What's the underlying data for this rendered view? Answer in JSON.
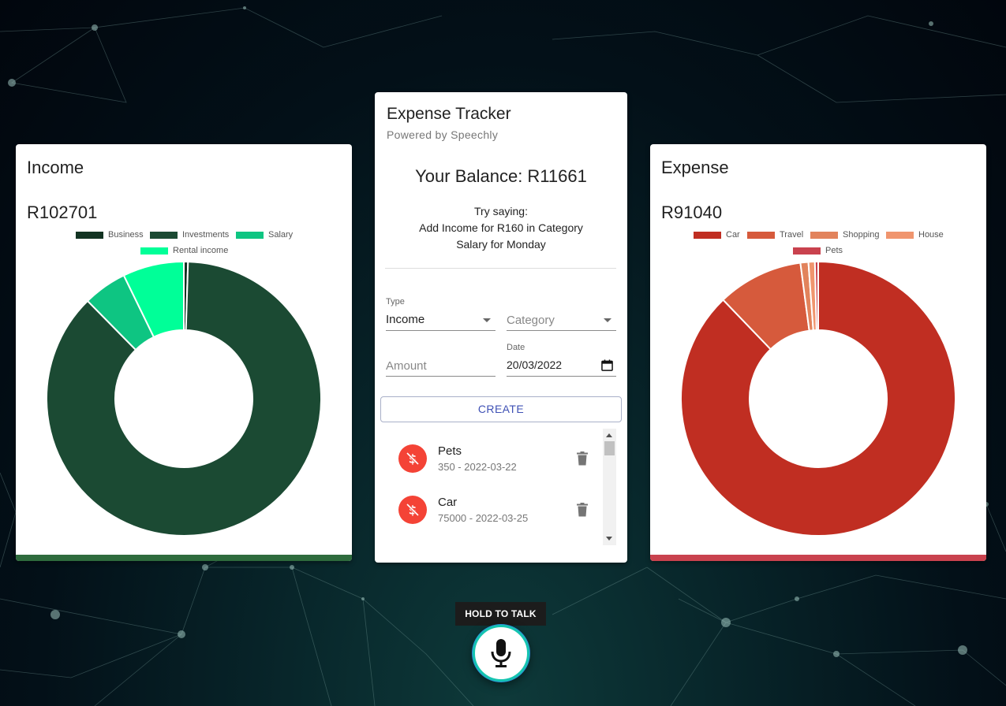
{
  "colors": {
    "income_bar": "#2e6b3d",
    "expense_bar": "#c9424e",
    "accent": "#3f51b5",
    "avatar": "#f44336"
  },
  "income": {
    "title": "Income",
    "amount": "R102701",
    "legend": [
      {
        "label": "Business",
        "color": "#123322"
      },
      {
        "label": "Investments",
        "color": "#1b4a33"
      },
      {
        "label": "Salary",
        "color": "#0ec582"
      },
      {
        "label": "Rental income",
        "color": "#00ff98"
      }
    ]
  },
  "tracker": {
    "title": "Expense Tracker",
    "subtitle": "Powered by Speechly",
    "balance": "Your Balance: R11661",
    "hint_lines": [
      "Try saying:",
      "Add Income for R160 in Category",
      "Salary for Monday"
    ],
    "type_label": "Type",
    "type_value": "Income",
    "category_placeholder": "Category",
    "amount_placeholder": "Amount",
    "date_label": "Date",
    "date_value": "20/03/2022",
    "create_label": "CREATE",
    "transactions": [
      {
        "name": "Pets",
        "detail": "350 - 2022-03-22",
        "icon": "money-off-icon"
      },
      {
        "name": "Car",
        "detail": "75000 - 2022-03-25",
        "icon": "money-off-icon"
      }
    ]
  },
  "expense": {
    "title": "Expense",
    "amount": "R91040",
    "legend": [
      {
        "label": "Car",
        "color": "#c02e22"
      },
      {
        "label": "Travel",
        "color": "#d65a3c"
      },
      {
        "label": "Shopping",
        "color": "#e2835c"
      },
      {
        "label": "House",
        "color": "#f0956e"
      },
      {
        "label": "Pets",
        "color": "#c9424e"
      }
    ]
  },
  "voice": {
    "label": "HOLD TO TALK",
    "icon": "microphone-icon"
  },
  "chart_data": [
    {
      "type": "pie",
      "title": "Income",
      "categories": [
        "Business",
        "Investments",
        "Salary",
        "Rental income"
      ],
      "values": [
        500,
        89501,
        5300,
        7400
      ],
      "colors": [
        "#123322",
        "#1b4a33",
        "#0ec582",
        "#00ff98"
      ],
      "legend": "top"
    },
    {
      "type": "pie",
      "title": "Expense",
      "categories": [
        "Car",
        "Travel",
        "Shopping",
        "House",
        "Pets"
      ],
      "values": [
        79950,
        9200,
        850,
        690,
        350
      ],
      "colors": [
        "#c02e22",
        "#d65a3c",
        "#e2835c",
        "#f0956e",
        "#c9424e"
      ],
      "legend": "top"
    }
  ]
}
